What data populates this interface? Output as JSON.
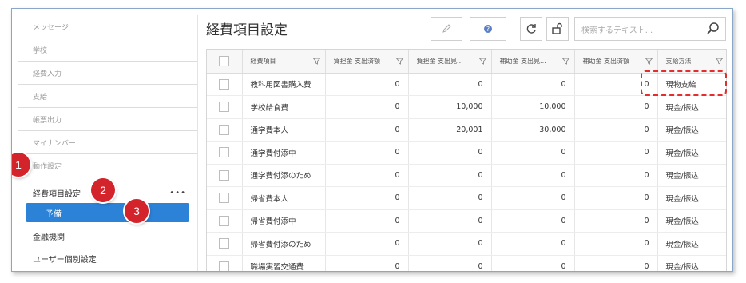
{
  "sidebar": {
    "menu": [
      "メッセージ",
      "学校",
      "経費入力",
      "支給",
      "帳票出力",
      "マイナンバー",
      "動作設定"
    ],
    "sub": [
      {
        "label": "経費項目設定",
        "more": "•••"
      },
      {
        "label": "予備"
      },
      {
        "label": "金融機関"
      },
      {
        "label": "ユーザー個別設定"
      }
    ]
  },
  "badges": [
    "1",
    "2",
    "3"
  ],
  "header": {
    "title": "経費項目設定"
  },
  "search": {
    "placeholder": "検索するテキスト..."
  },
  "columns": [
    "経費項目",
    "負担金 支出済額",
    "負担金 支出見...",
    "補助金 支出見...",
    "補助金 支出済額",
    "支給方法"
  ],
  "rows": [
    [
      "教科用図書購入費",
      "0",
      "0",
      "0",
      "0",
      "現物支給"
    ],
    [
      "学校給食費",
      "0",
      "10,000",
      "10,000",
      "0",
      "現金/振込"
    ],
    [
      "通学費本人",
      "0",
      "20,001",
      "30,000",
      "0",
      "現金/振込"
    ],
    [
      "通学費付添中",
      "0",
      "0",
      "0",
      "0",
      "現金/振込"
    ],
    [
      "通学費付添のため",
      "0",
      "0",
      "0",
      "0",
      "現金/振込"
    ],
    [
      "帰省費本人",
      "0",
      "0",
      "0",
      "0",
      "現金/振込"
    ],
    [
      "帰省費付添中",
      "0",
      "0",
      "0",
      "0",
      "現金/振込"
    ],
    [
      "帰省費付添のため",
      "0",
      "0",
      "0",
      "0",
      "現金/振込"
    ],
    [
      "職場実習交通費",
      "0",
      "0",
      "0",
      "0",
      "現金/振込"
    ]
  ],
  "colors": {
    "accent": "#2c82d6",
    "badge": "#d3232b",
    "highlight": "#e52d2d"
  }
}
